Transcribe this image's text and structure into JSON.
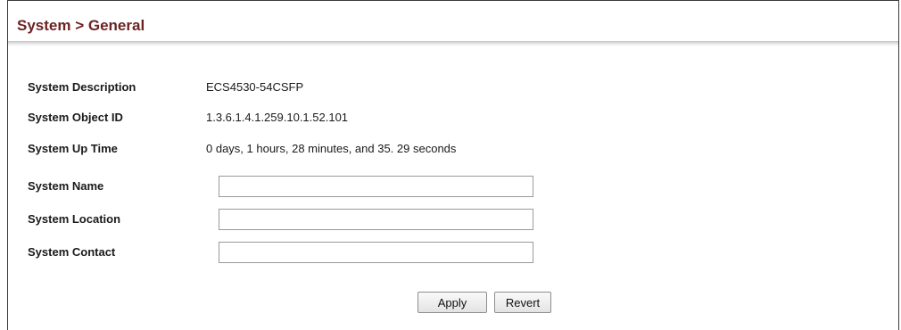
{
  "header": {
    "title": "System > General"
  },
  "system_info": {
    "description": {
      "label": "System Description",
      "value": "ECS4530-54CSFP"
    },
    "object_id": {
      "label": "System Object ID",
      "value": "1.3.6.1.4.1.259.10.1.52.101"
    },
    "up_time": {
      "label": "System Up Time",
      "value": "0 days, 1 hours, 28 minutes, and 35. 29 seconds"
    }
  },
  "fields": {
    "name": {
      "label": "System Name",
      "value": ""
    },
    "location": {
      "label": "System Location",
      "value": ""
    },
    "contact": {
      "label": "System Contact",
      "value": ""
    }
  },
  "buttons": {
    "apply": "Apply",
    "revert": "Revert"
  },
  "colors": {
    "title": "#6b2323",
    "border": "#3a3a3a"
  }
}
